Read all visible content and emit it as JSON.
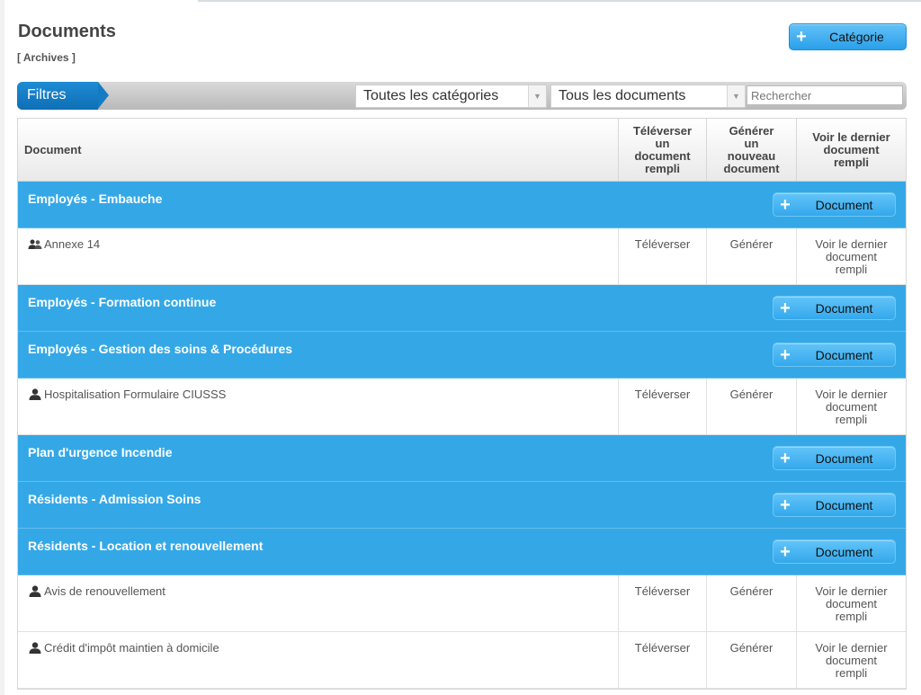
{
  "page": {
    "title": "Documents",
    "archives_link": "[ Archives ]",
    "category_button": "Catégorie"
  },
  "filters": {
    "tab_label": "Filtres",
    "category_select": "Toutes les catégories",
    "document_select": "Tous les documents",
    "search_placeholder": "Rechercher"
  },
  "table": {
    "headers": {
      "document": "Document",
      "upload": [
        "Téléverser",
        "un",
        "document",
        "rempli"
      ],
      "generate": [
        "Générer",
        "un",
        "nouveau",
        "document"
      ],
      "view_last": [
        "Voir le dernier",
        "document",
        "rempli"
      ]
    },
    "add_document_label": "Document",
    "action_labels": {
      "upload": "Téléverser",
      "generate": "Générer",
      "view_last": [
        "Voir le dernier",
        "document",
        "rempli"
      ]
    },
    "categories": [
      {
        "name": "Employés - Embauche",
        "documents": [
          {
            "name": "Annexe 14",
            "icon": "group-icon"
          }
        ]
      },
      {
        "name": "Employés - Formation continue",
        "documents": []
      },
      {
        "name": "Employés - Gestion des soins & Procédures",
        "documents": [
          {
            "name": "Hospitalisation Formulaire CIUSSS",
            "icon": "user-icon"
          }
        ]
      },
      {
        "name": "Plan d'urgence Incendie",
        "documents": []
      },
      {
        "name": "Résidents - Admission Soins",
        "documents": []
      },
      {
        "name": "Résidents - Location et renouvellement",
        "documents": [
          {
            "name": "Avis de renouvellement",
            "icon": "user-icon"
          },
          {
            "name": "Crédit d'impôt maintien à domicile",
            "icon": "user-icon"
          }
        ]
      }
    ]
  },
  "colors": {
    "category_bar": "#34a8e7",
    "filter_tab": "#1e8bd3",
    "button_blue": "#2aa0ea"
  }
}
